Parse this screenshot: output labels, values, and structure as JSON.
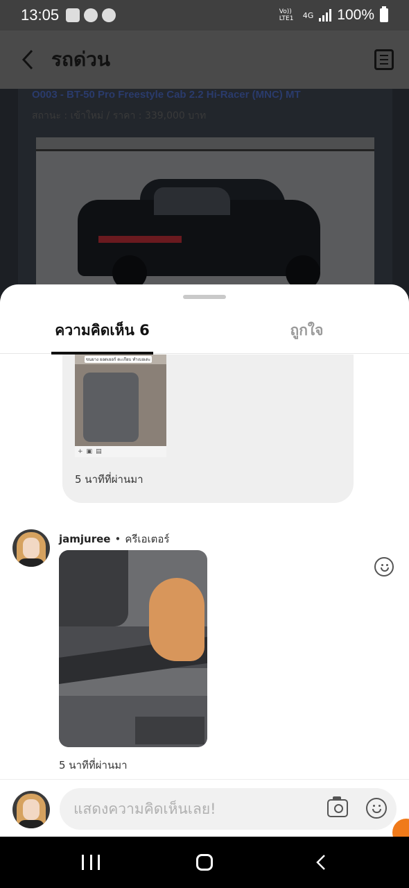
{
  "status_bar": {
    "time": "13:05",
    "battery": "100%",
    "network": "4G",
    "volte": "Vo)) LTE1"
  },
  "header": {
    "title": "รถด่วน"
  },
  "background": {
    "car_title": "O003 - BT-50 Pro Freestyle Cab 2.2 Hi-Racer (MNC) MT",
    "car_subtitle": "สถานะ : เข้าใหม่ / ราคา : 339,000 บาท"
  },
  "tabs": [
    {
      "label": "ความคิดเห็น 6",
      "active": true
    },
    {
      "label": "ถูกใจ",
      "active": false
    }
  ],
  "previous_comment": {
    "time": "5 นาทีที่ผ่านมา",
    "image_caption": "ขนยาง ยอดเยอร์ ตะเกียบ ทำเบอเดะ"
  },
  "comment": {
    "username": "jamjuree",
    "separator": "•",
    "role": "ครีเอเตอร์",
    "time": "5 นาทีที่ผ่านมา"
  },
  "input": {
    "placeholder": "แสดงความคิดเห็นเลย!"
  },
  "colors": {
    "accent": "#f07a1a",
    "active_tab": "#111111",
    "inactive_tab": "#9a9a9a"
  }
}
